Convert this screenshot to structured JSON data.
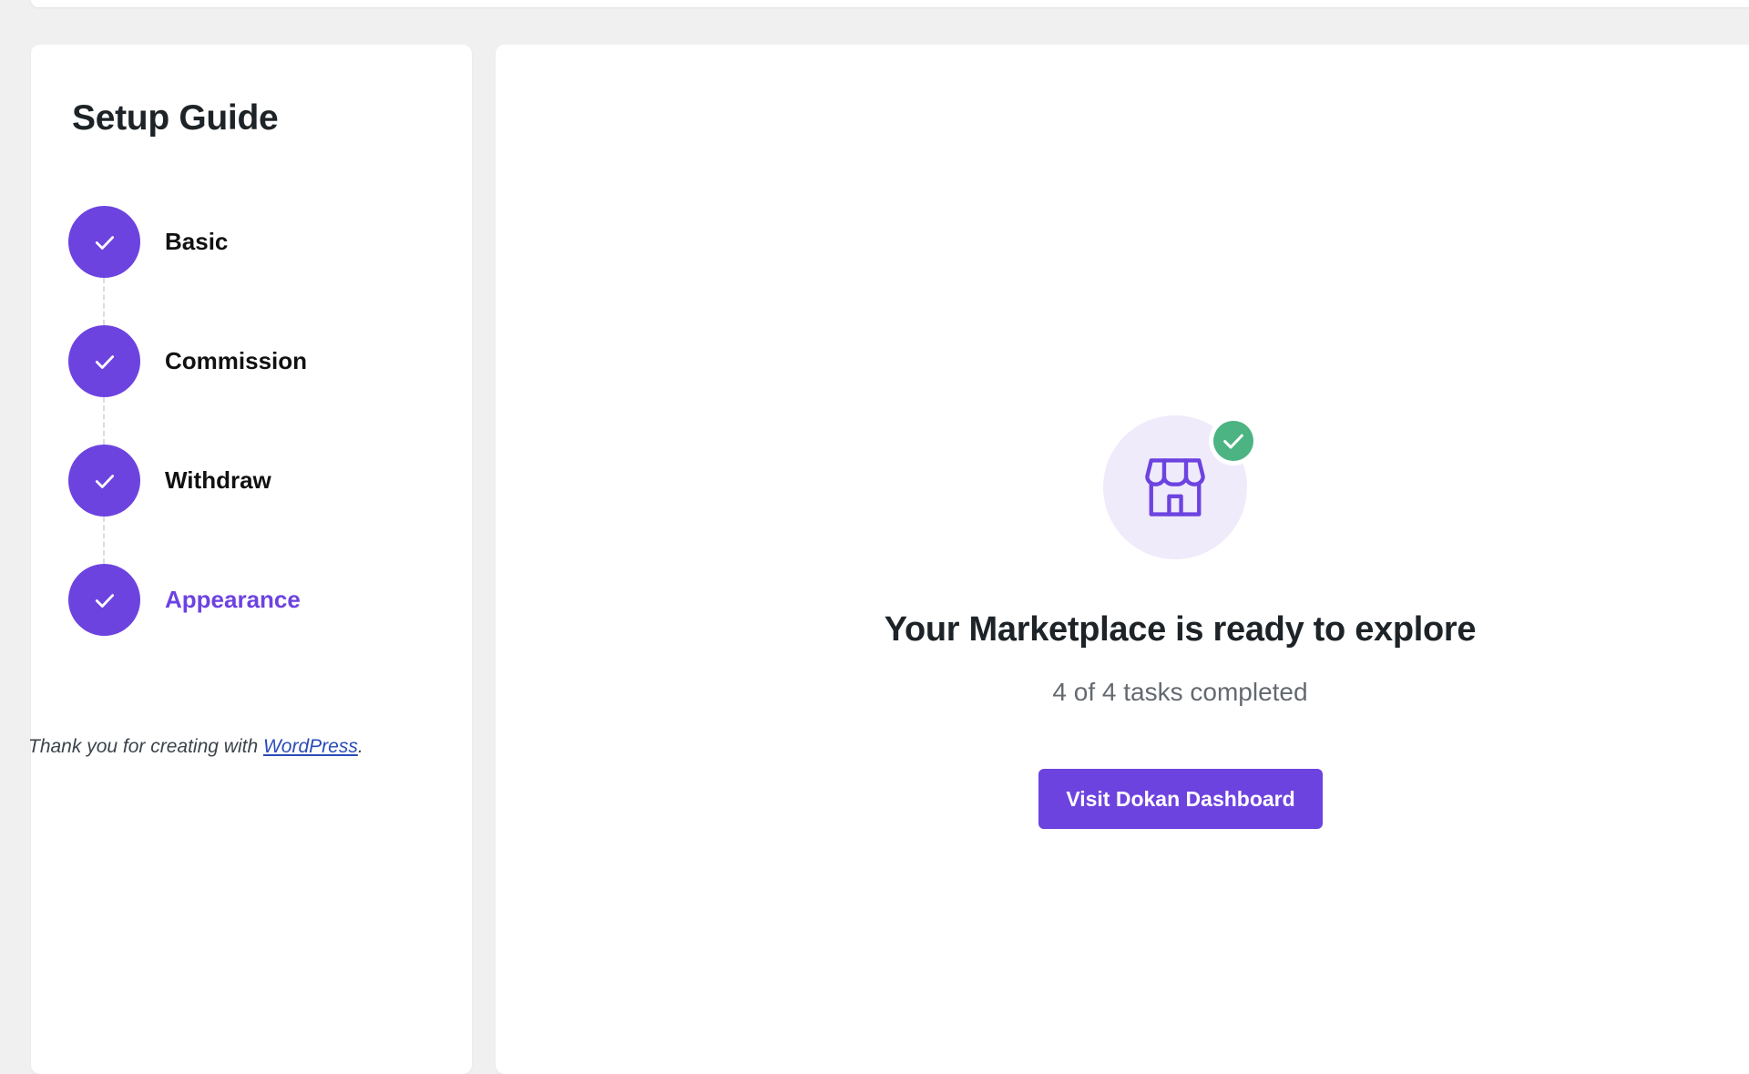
{
  "colors": {
    "accent": "#6d43e0",
    "success": "#4cb383",
    "page_background": "#f0f0f1",
    "link": "#2a4bb7"
  },
  "sidebar": {
    "title": "Setup Guide",
    "steps": [
      {
        "label": "Basic",
        "icon": "check-icon",
        "completed": true,
        "active": false
      },
      {
        "label": "Commission",
        "icon": "check-icon",
        "completed": true,
        "active": false
      },
      {
        "label": "Withdraw",
        "icon": "check-icon",
        "completed": true,
        "active": false
      },
      {
        "label": "Appearance",
        "icon": "check-icon",
        "completed": true,
        "active": true
      }
    ]
  },
  "footer": {
    "thanks_prefix": "Thank you for creating with ",
    "link_label": "WordPress",
    "thanks_suffix": "."
  },
  "main": {
    "icon": "store-icon",
    "badge_icon": "check-badge-icon",
    "headline": "Your Marketplace is ready to explore",
    "progress_text": "4 of 4 tasks completed",
    "cta_label": "Visit Dokan Dashboard"
  }
}
